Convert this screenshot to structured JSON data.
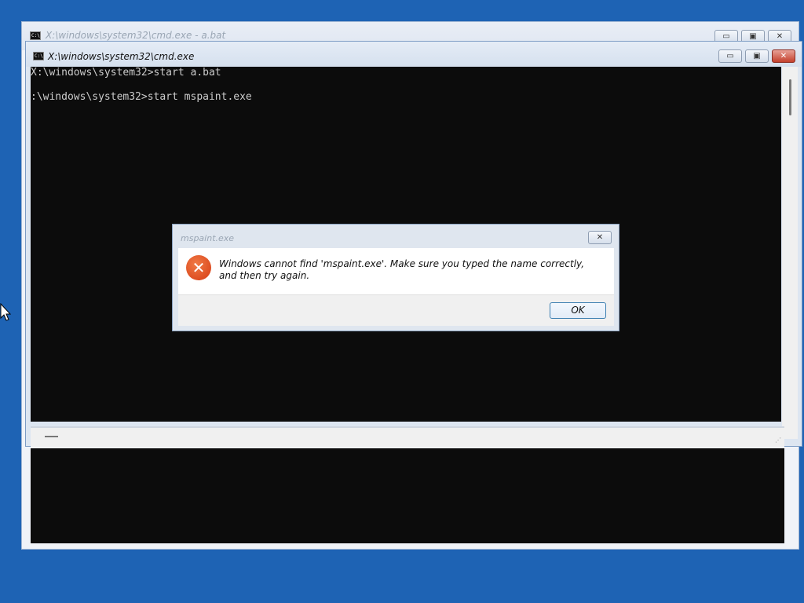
{
  "back_window": {
    "title": "X:\\windows\\system32\\cmd.exe - a.bat",
    "icon": "cmd-icon",
    "minimize": "▭",
    "maximize": "▣",
    "close": "✕"
  },
  "front_window": {
    "title": "X:\\windows\\system32\\cmd.exe",
    "icon": "cmd-icon",
    "minimize": "▭",
    "maximize": "▣",
    "close": "✕",
    "console_text": "X:\\windows\\system32>start a.bat\n:\\windows\\system32>start mspaint.exe"
  },
  "dialog": {
    "title": "mspaint.exe",
    "close": "✕",
    "icon": "error-icon",
    "icon_glyph": "✕",
    "message": "Windows cannot find 'mspaint.exe'. Make sure you typed the name correctly, and then try again.",
    "ok_label": "OK"
  },
  "icon_glyphs": {
    "cmd": "C:\\"
  },
  "colors": {
    "desktop": "#1e63b4",
    "console_bg": "#0c0c0c",
    "error_red": "#d63c14",
    "close_red": "#c4402c"
  }
}
